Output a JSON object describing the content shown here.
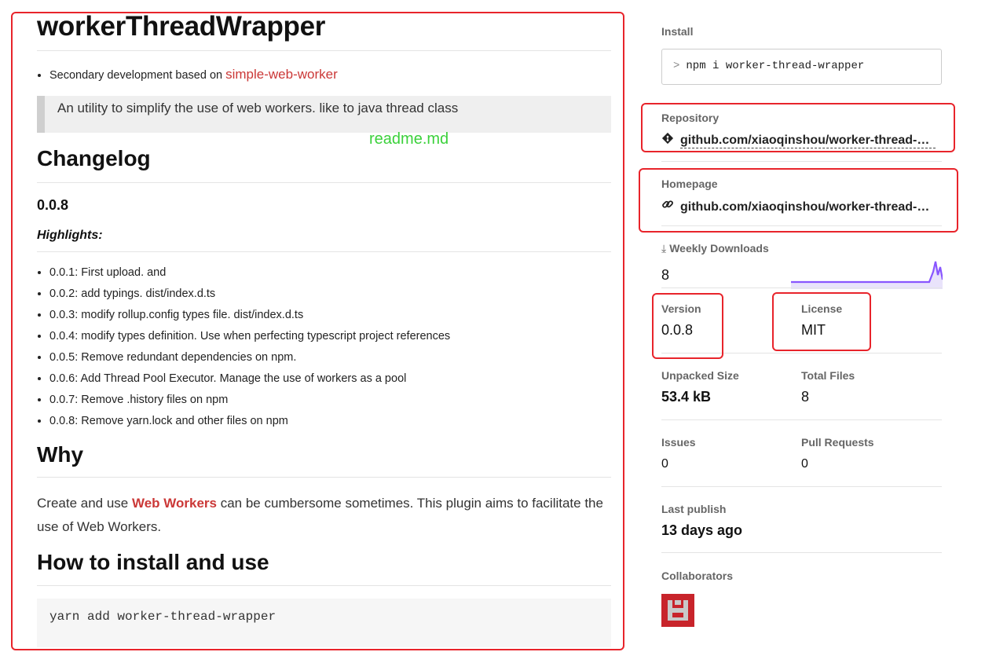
{
  "readme": {
    "title": "workerThreadWrapper",
    "intro_prefix": "Secondary development based on ",
    "intro_link": "simple-web-worker",
    "blockquote": "An utility to simplify the use of web workers. like to java thread class",
    "annotation": "readme.md",
    "changelog_heading": "Changelog",
    "version_heading": "0.0.8",
    "highlights_heading": "Highlights:",
    "changelog_items": [
      "0.0.1: First upload. and",
      "0.0.2: add typings. dist/index.d.ts",
      "0.0.3: modify rollup.config types file. dist/index.d.ts",
      "0.0.4: modify types definition. Use when perfecting typescript project references",
      "0.0.5: Remove redundant dependencies on npm.",
      "0.0.6: Add Thread Pool Executor. Manage the use of workers as a pool",
      "0.0.7: Remove .history files on npm",
      "0.0.8: Remove yarn.lock and other files on npm"
    ],
    "why_heading": "Why",
    "why_prefix": "Create and use ",
    "why_link": "Web Workers",
    "why_suffix": " can be cumbersome sometimes. This plugin aims to facilitate the use of Web Workers.",
    "install_heading": "How to install and use",
    "code": "yarn add worker-thread-wrapper"
  },
  "sidebar": {
    "install_label": "Install",
    "install_prompt": ">",
    "install_cmd": "npm i worker-thread-wrapper",
    "repository_label": "Repository",
    "repository_url": "github.com/xiaoqinshou/worker-thread-wrapper",
    "homepage_label": "Homepage",
    "homepage_url": "github.com/xiaoqinshou/worker-thread-wrapper",
    "downloads_label": "Weekly Downloads",
    "downloads_value": "8",
    "version_label": "Version",
    "version_value": "0.0.8",
    "license_label": "License",
    "license_value": "MIT",
    "unpacked_label": "Unpacked Size",
    "unpacked_value": "53.4 kB",
    "files_label": "Total Files",
    "files_value": "8",
    "issues_label": "Issues",
    "issues_value": "0",
    "pr_label": "Pull Requests",
    "pr_value": "0",
    "last_publish_label": "Last publish",
    "last_publish_value": "13 days ago",
    "collaborators_label": "Collaborators"
  },
  "colors": {
    "npm_red": "#cb3837",
    "highlight_red": "#e8242b",
    "annotation_green": "#3bd13b",
    "sparkline": "#8956ff"
  },
  "icons": [
    "git-icon",
    "link-icon",
    "download-icon",
    "prompt-icon"
  ]
}
